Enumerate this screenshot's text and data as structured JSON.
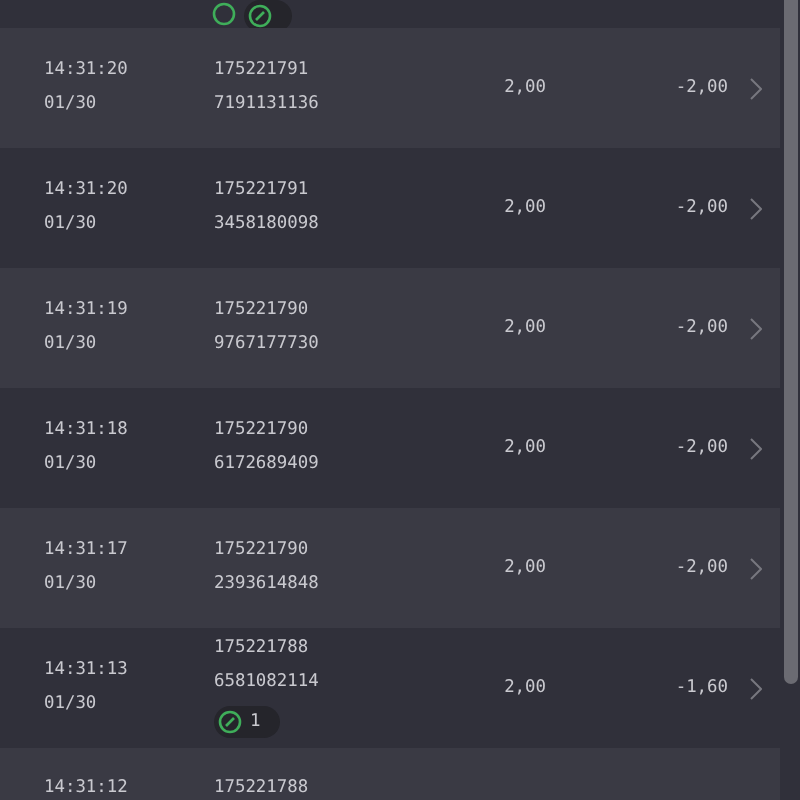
{
  "rows": [
    {
      "time": "14:31:20",
      "date": "01/30",
      "order": "175221791",
      "id": "7191131136",
      "qty": "2,00",
      "amount": "-2,00"
    },
    {
      "time": "14:31:20",
      "date": "01/30",
      "order": "175221791",
      "id": "3458180098",
      "qty": "2,00",
      "amount": "-2,00"
    },
    {
      "time": "14:31:19",
      "date": "01/30",
      "order": "175221790",
      "id": "9767177730",
      "qty": "2,00",
      "amount": "-2,00"
    },
    {
      "time": "14:31:18",
      "date": "01/30",
      "order": "175221790",
      "id": "6172689409",
      "qty": "2,00",
      "amount": "-2,00"
    },
    {
      "time": "14:31:17",
      "date": "01/30",
      "order": "175221790",
      "id": "2393614848",
      "qty": "2,00",
      "amount": "-2,00"
    },
    {
      "time": "14:31:13",
      "date": "01/30",
      "order": "175221788",
      "id": "6581082114",
      "qty": "2,00",
      "amount": "-1,60",
      "badge": "1"
    },
    {
      "time": "14:31:12",
      "order": "175221788"
    }
  ]
}
